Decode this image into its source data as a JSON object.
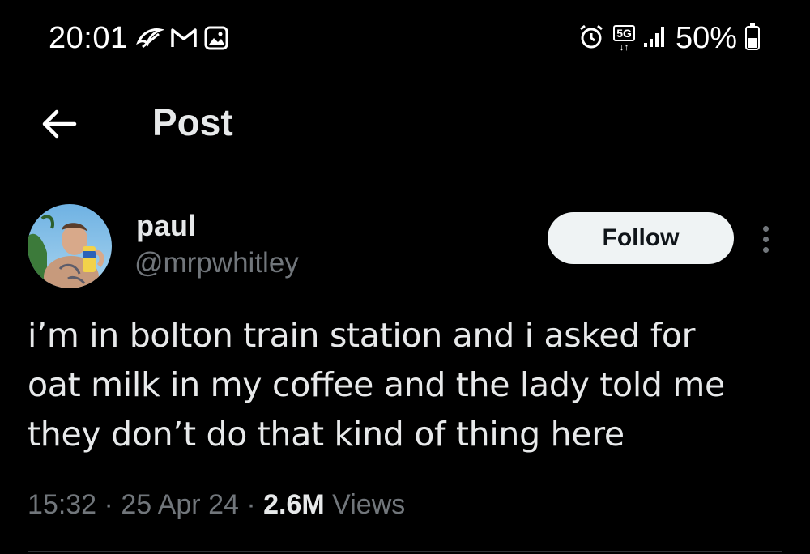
{
  "status_bar": {
    "time": "20:01",
    "left_icons": [
      "swift-icon",
      "gmail-icon",
      "gallery-icon"
    ],
    "network_label": "5G",
    "battery_percent": "50%",
    "battery_level": 0.5
  },
  "header": {
    "title": "Post"
  },
  "post": {
    "display_name": "paul",
    "handle": "@mrpwhitley",
    "follow_label": "Follow",
    "text_lines": [
      "i’m in bolton train station and i asked for",
      "oat milk in my coffee and the lady told me",
      "they don’t do that kind of thing here"
    ],
    "time": "15:32",
    "date": "25 Apr 24",
    "views_count": "2.6M",
    "views_label": "Views",
    "separator": "·"
  },
  "colors": {
    "background": "#000000",
    "text_primary": "#e7e9ea",
    "text_secondary": "#71767b",
    "follow_bg": "#eff3f4",
    "divider": "#2f3336"
  }
}
